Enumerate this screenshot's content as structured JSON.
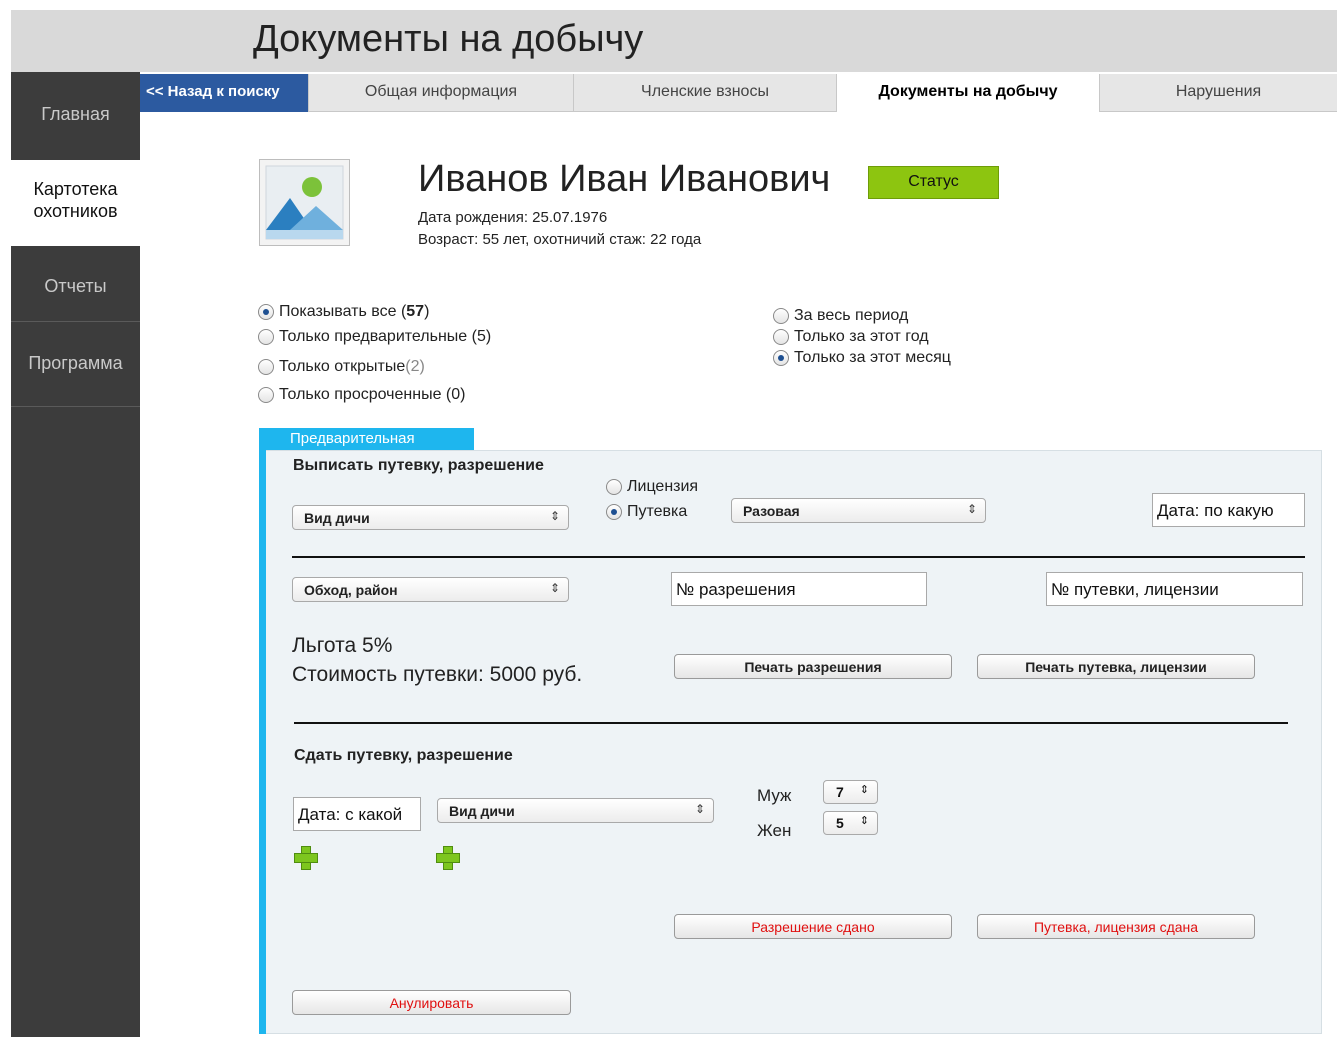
{
  "header": {
    "title": "Документы на добычу"
  },
  "sidebar": {
    "items": [
      {
        "label": "Главная"
      },
      {
        "label": "Картотека охотников"
      },
      {
        "label": "Отчеты"
      },
      {
        "label": "Программа"
      }
    ]
  },
  "tabs": {
    "back": "<< Назад к поиску",
    "items": [
      {
        "label": "Общая информация"
      },
      {
        "label": "Членские взносы"
      },
      {
        "label": "Документы на добычу"
      },
      {
        "label": "Нарушения"
      }
    ],
    "active": "Документы на добычу"
  },
  "profile": {
    "name": "Иванов Иван Иванович",
    "status_label": "Статус",
    "birth": "Дата рождения: 25.07.1976",
    "age": "Возраст: 55 лет, охотничий стаж: 22 года"
  },
  "filters": {
    "show_all": "Показывать все (",
    "show_all_count": "57",
    "show_all_close": ")",
    "prelim": "Только предварительные (5)",
    "open": "Только открытые ",
    "open_count": "(2)",
    "overdue": "Только просроченные (0)",
    "period_all": "За весь период",
    "period_year": "Только за этот год",
    "period_month": "Только за этот месяц",
    "selected_filter": "Показывать все",
    "selected_period": "Только за этот месяц"
  },
  "panel": {
    "tab_label": "Предварительная",
    "issue_title": "Выписать путевку, разрешение",
    "game_select": "Вид дичи",
    "license_label": "Лицензия",
    "voucher_label": "Путевка",
    "type_select": "Разовая",
    "date_to": "Дата: по какую",
    "area_select": "Обход, район",
    "permit_no": "№ разрешения",
    "voucher_no": "№ путевки, лицензии",
    "discount": "Льгота 5%",
    "cost": "Стоимость путевки:  5000 руб.",
    "print_permit": "Печать разрешения",
    "print_voucher": "Печать путевка, лицензии",
    "return_title": "Сдать путевку, разрешение",
    "date_from": "Дата: с какой",
    "game_select_2": "Вид дичи",
    "male_label": "Муж",
    "male_count": "7",
    "female_label": "Жен",
    "female_count": "5",
    "permit_returned": "Разрешение сдано",
    "voucher_returned": "Путевка, лицензия сдана",
    "cancel": "Анулировать"
  }
}
